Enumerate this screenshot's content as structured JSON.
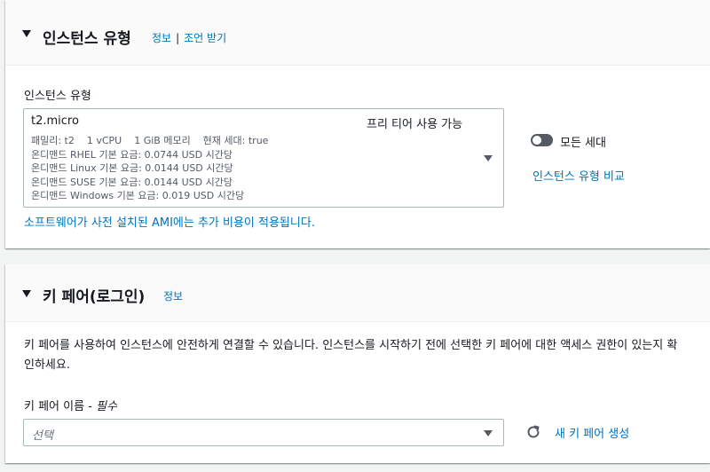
{
  "instance_type_section": {
    "title": "인스턴스 유형",
    "info_link": "정보",
    "separator": "|",
    "advice_link": "조언 받기",
    "field_label": "인스턴스 유형",
    "selected": {
      "name": "t2.micro",
      "free_tier": "프리 티어 사용 가능",
      "specs": "패밀리: t2    1 vCPU    1 GiB 메모리    현재 세대: true",
      "pricing": [
        "온디맨드 RHEL 기본 요금: 0.0744 USD 시간당",
        "온디맨드 Linux 기본 요금: 0.0144 USD 시간당",
        "온디맨드 SUSE 기본 요금: 0.0144 USD 시간당",
        "온디맨드 Windows 기본 요금: 0.019 USD 시간당"
      ]
    },
    "all_generations_label": "모든 세대",
    "all_generations_enabled": false,
    "compare_link": "인스턴스 유형 비교",
    "ami_notice": "소프트웨어가 사전 설치된 AMI에는 추가 비용이 적용됩니다."
  },
  "key_pair_section": {
    "title": "키 페어(로그인)",
    "info_link": "정보",
    "description": "키 페어를 사용하여 인스턴스에 안전하게 연결할 수 있습니다. 인스턴스를 시작하기 전에 선택한 키 페어에 대한 액세스 권한이 있는지 확인하세요.",
    "field_label": "키 페어 이름 - ",
    "required_label": "필수",
    "select_placeholder": "선택",
    "create_link": "새 키 페어 생성"
  },
  "colors": {
    "link": "#0073bb",
    "text": "#16191f",
    "secondary_text": "#545b64",
    "background": "#f2f3f3"
  },
  "icons": [
    "caret-down-icon",
    "dropdown-arrow-icon",
    "toggle-switch",
    "refresh-icon"
  ]
}
